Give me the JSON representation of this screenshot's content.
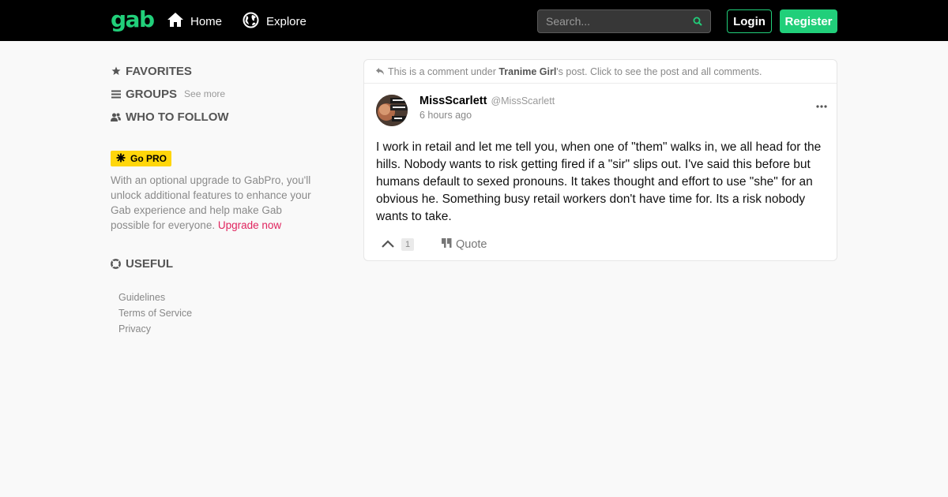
{
  "header": {
    "logo": "gab",
    "nav": [
      {
        "label": "Home",
        "icon": "home-icon"
      },
      {
        "label": "Explore",
        "icon": "globe-icon"
      }
    ],
    "search_placeholder": "Search...",
    "login_label": "Login",
    "register_label": "Register",
    "accent_color": "#21cf7a"
  },
  "sidebar": {
    "favorites_label": "FAVORITES",
    "groups_label": "GROUPS",
    "groups_see_more": "See more",
    "who_to_follow_label": "WHO TO FOLLOW",
    "gopro_badge": "Go PRO",
    "gopro_text": "With an optional upgrade to GabPro, you'll unlock additional features to enhance your Gab experience and help make Gab possible for everyone.",
    "upgrade_link": "Upgrade now",
    "useful_label": "USEFUL",
    "footer_links": [
      "Guidelines",
      "Terms of Service",
      "Privacy"
    ]
  },
  "post": {
    "context_prefix": "This is a comment under",
    "context_author": "Tranime Girl",
    "context_suffix": "'s post. Click to see the post and all comments.",
    "author_name": "MissScarlett",
    "author_handle": "@MissScarlett",
    "timestamp": "6 hours ago",
    "body": "I work in retail and let me tell you, when one of \"them\" walks in, we all head for the hills. Nobody wants to risk getting fired if a \"sir\" slips out. I've said this before but humans default to sexed pronouns. It takes thought and effort to use \"she\" for an obvious he. Something busy retail workers don't have time for. Its a risk nobody wants to take.",
    "score": "1",
    "quote_label": "Quote"
  }
}
